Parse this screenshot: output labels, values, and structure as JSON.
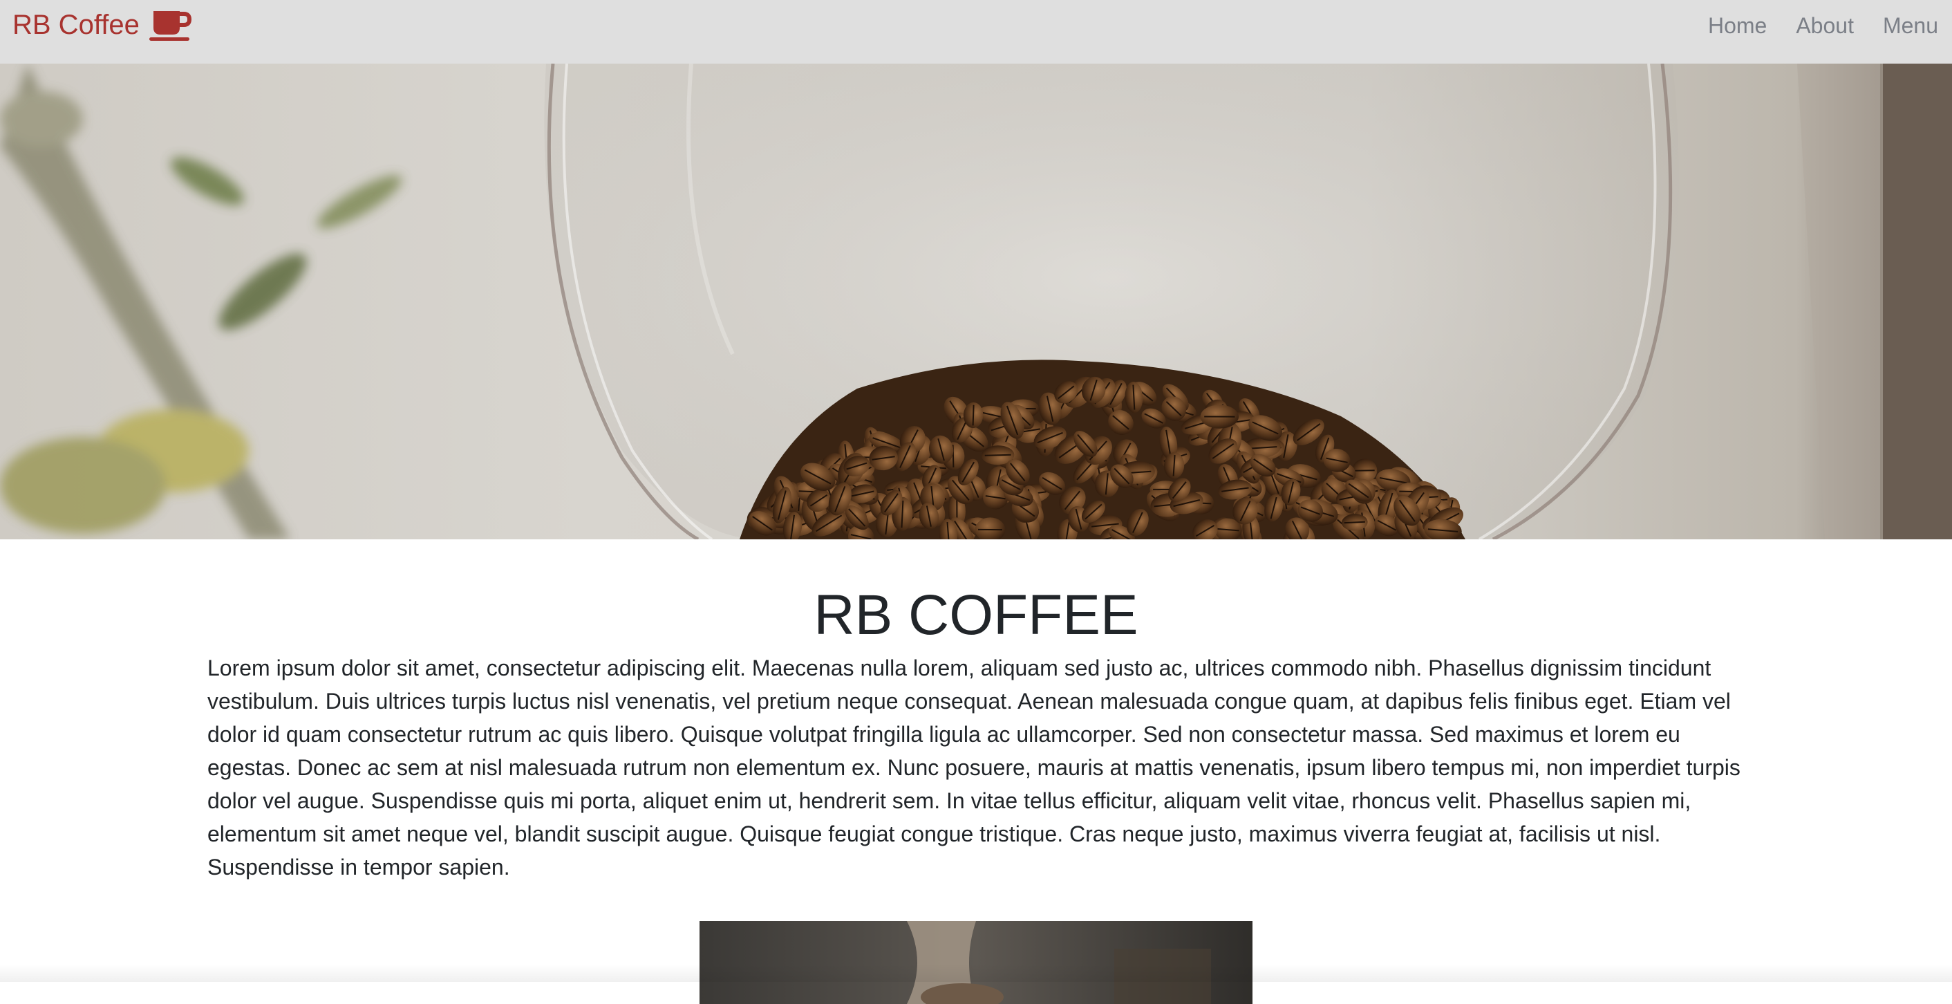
{
  "navbar": {
    "brand_label": "RB Coffee",
    "brand_icon": "coffee-mug-icon",
    "links": [
      {
        "label": "Home"
      },
      {
        "label": "About"
      },
      {
        "label": "Menu"
      }
    ],
    "background": "#dfdfdf",
    "brand_color": "#a8332f",
    "link_color": "#7b7f87"
  },
  "hero": {
    "image": "coffee-beans-in-glass-bowl"
  },
  "main": {
    "title": "RB COFFEE",
    "body": "Lorem ipsum dolor sit amet, consectetur adipiscing elit. Maecenas nulla lorem, aliquam sed justo ac, ultrices commodo nibh. Phasellus dignissim tincidunt vestibulum. Duis ultrices turpis luctus nisl venenatis, vel pretium neque consequat. Aenean malesuada congue quam, at dapibus felis finibus eget. Etiam vel dolor id quam consectetur rutrum ac quis libero. Quisque volutpat fringilla ligula ac ullamcorper. Sed non consectetur massa. Sed maximus et lorem eu egestas. Donec ac sem at nisl malesuada rutrum non elementum ex. Nunc posuere, mauris at mattis venenatis, ipsum libero tempus mi, non imperdiet turpis dolor vel augue. Suspendisse quis mi porta, aliquet enim ut, hendrerit sem. In vitae tellus efficitur, aliquam velit vitae, rhoncus velit. Phasellus sapien mi, elementum sit amet neque vel, blandit suscipit augue. Quisque feugiat congue tristique. Cras neque justo, maximus viverra feugiat at, facilisis ut nisl. Suspendisse in tempor sapien.",
    "text_color": "#212529"
  },
  "secondary_image": {
    "image": "coffee-pour-photo"
  }
}
